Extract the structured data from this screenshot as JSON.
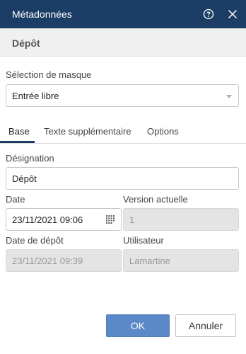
{
  "window": {
    "title": "Métadonnées",
    "help_icon": "help-circle-icon",
    "close_icon": "close-icon"
  },
  "subheader": {
    "title": "Dépôt"
  },
  "mask": {
    "label": "Sélection de masque",
    "value": "Entrée libre"
  },
  "tabs": [
    {
      "label": "Base",
      "active": true
    },
    {
      "label": "Texte supplémentaire",
      "active": false
    },
    {
      "label": "Options",
      "active": false
    }
  ],
  "form": {
    "designation": {
      "label": "Désignation",
      "value": "Dépôt"
    },
    "date": {
      "label": "Date",
      "value": "23/11/2021 09:06",
      "icon": "calendar-icon"
    },
    "version": {
      "label": "Version actuelle",
      "value": "1"
    },
    "deposit_date": {
      "label": "Date de dépôt",
      "value": "23/11/2021 09:39"
    },
    "user": {
      "label": "Utilisateur",
      "value": "Lamartine"
    }
  },
  "buttons": {
    "ok": "OK",
    "cancel": "Annuler"
  },
  "colors": {
    "titlebar": "#1c3d66",
    "primary_button": "#5b88c8"
  }
}
